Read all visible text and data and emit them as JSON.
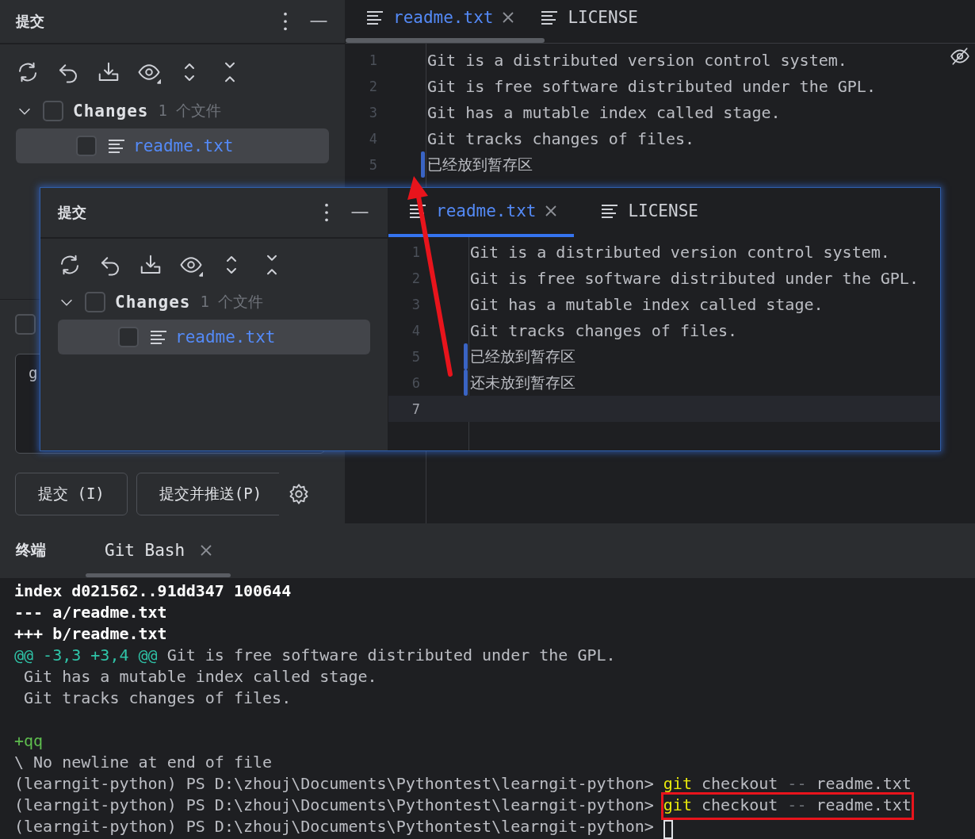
{
  "commit_panel": {
    "title": "提交",
    "tree": {
      "label": "Changes",
      "count": "1 个文件",
      "expanded": true,
      "checked": false,
      "children": [
        {
          "name": "readme.txt",
          "checked": false,
          "selected": true
        }
      ]
    },
    "amend": {
      "checked": false
    },
    "message": {
      "value": "g"
    },
    "buttons": [
      {
        "label": "提交 (I)"
      },
      {
        "label": "提交并推送(P)"
      }
    ]
  },
  "editor": {
    "tabs": [
      {
        "label": "readme.txt",
        "selected": true,
        "closable": true
      },
      {
        "label": "LICENSE",
        "selected": false,
        "closable": false
      }
    ],
    "lines": [
      {
        "number": "1",
        "text": "Git is a distributed version control system.",
        "changed": false,
        "current": false
      },
      {
        "number": "2",
        "text": "Git is free software distributed under the GPL.",
        "changed": false,
        "current": false
      },
      {
        "number": "3",
        "text": "Git has a mutable index called stage.",
        "changed": false,
        "current": false
      },
      {
        "number": "4",
        "text": "Git tracks changes of files.",
        "changed": false,
        "current": false
      },
      {
        "number": "5",
        "text": "已经放到暂存区",
        "changed": true,
        "current": false
      }
    ]
  },
  "inset": {
    "commit_panel": {
      "title": "提交",
      "tree": {
        "label": "Changes",
        "count": "1 个文件",
        "expanded": true,
        "checked": false,
        "children": [
          {
            "name": "readme.txt",
            "checked": false,
            "selected": true
          }
        ]
      }
    },
    "editor": {
      "tabs": [
        {
          "label": "readme.txt",
          "selected": true,
          "closable": true
        },
        {
          "label": "LICENSE",
          "selected": false,
          "closable": false
        }
      ],
      "lines": [
        {
          "number": "1",
          "text": "Git is a distributed version control system.",
          "changed": false,
          "current": false
        },
        {
          "number": "2",
          "text": "Git is free software distributed under the GPL.",
          "changed": false,
          "current": false
        },
        {
          "number": "3",
          "text": "Git has a mutable index called stage.",
          "changed": false,
          "current": false
        },
        {
          "number": "4",
          "text": "Git tracks changes of files.",
          "changed": false,
          "current": false
        },
        {
          "number": "5",
          "text": "已经放到暂存区",
          "changed": true,
          "current": false
        },
        {
          "number": "6",
          "text": "还未放到暂存区",
          "changed": true,
          "current": false
        },
        {
          "number": "7",
          "changed": false,
          "current": true
        }
      ]
    }
  },
  "terminal": {
    "title": "终端",
    "tabs": [
      {
        "label": "Git Bash",
        "selected": true
      }
    ],
    "lines": [
      {
        "segments": [
          {
            "text": "index d021562..91dd347 100644",
            "kind": "header"
          }
        ]
      },
      {
        "segments": [
          {
            "text": "--- a/readme.txt",
            "kind": "header"
          }
        ]
      },
      {
        "segments": [
          {
            "text": "+++ b/readme.txt",
            "kind": "header"
          }
        ]
      },
      {
        "segments": [
          {
            "text": "@@ -3,3 +3,4 @@",
            "kind": "hunk"
          },
          {
            "text": " Git is free software distributed under the GPL.",
            "kind": "plain"
          }
        ]
      },
      {
        "segments": [
          {
            "text": " Git has a mutable index called stage.",
            "kind": "plain"
          }
        ]
      },
      {
        "segments": [
          {
            "text": " Git tracks changes of files.",
            "kind": "plain"
          }
        ]
      },
      {
        "segments": [
          {
            "text": "+qq",
            "kind": "added"
          }
        ],
        "gap_before": true
      },
      {
        "segments": [
          {
            "text": "\\ No newline at end of file",
            "kind": "plain"
          }
        ]
      },
      {
        "segments": [
          {
            "text": "(learngit-python) PS D:\\zhouj\\Documents\\Pythontest\\learngit-python> ",
            "kind": "plain"
          },
          {
            "text": "git",
            "kind": "command"
          },
          {
            "text": " checkout ",
            "kind": "plain"
          },
          {
            "text": "--",
            "kind": "flag"
          },
          {
            "text": " readme.txt",
            "kind": "plain"
          }
        ]
      },
      {
        "segments": [
          {
            "text": "(learngit-python) PS D:\\zhouj\\Documents\\Pythontest\\learngit-python> ",
            "kind": "plain"
          },
          {
            "text": "git",
            "kind": "command"
          },
          {
            "text": " checkout ",
            "kind": "plain"
          },
          {
            "text": "--",
            "kind": "flag"
          },
          {
            "text": " readme.txt",
            "kind": "plain"
          }
        ],
        "boxed": true
      },
      {
        "segments": [
          {
            "text": "(learngit-python) PS D:\\zhouj\\Documents\\Pythontest\\learngit-python> ",
            "kind": "plain"
          }
        ],
        "cursor": true
      }
    ]
  },
  "annotations": [
    {
      "kind": "arrow"
    }
  ]
}
